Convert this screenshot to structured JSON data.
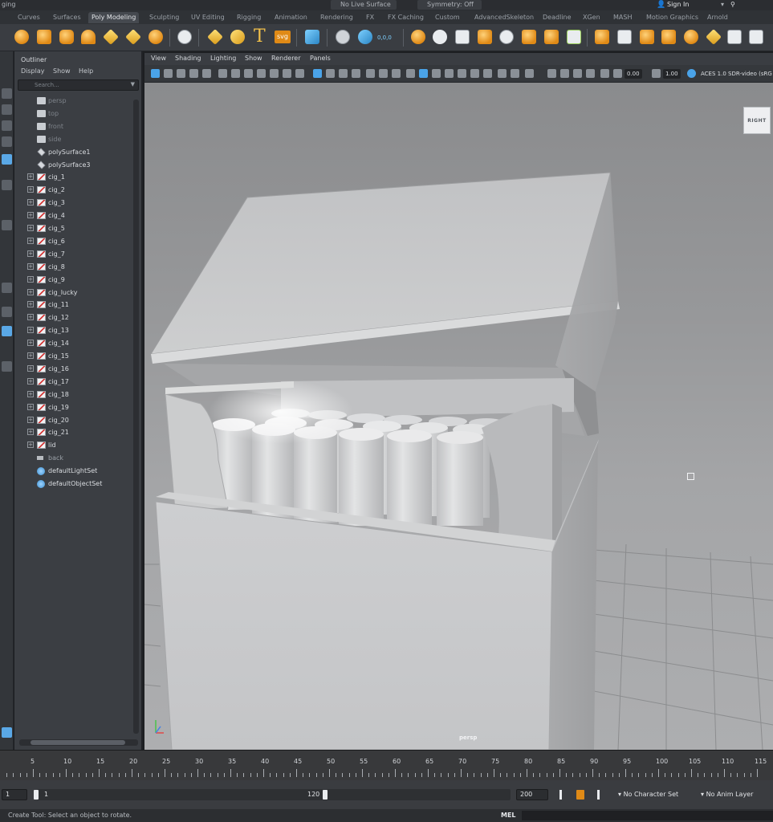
{
  "topbar": {
    "mode": "ging",
    "live_surface": "No Live Surface",
    "symmetry": "Symmetry: Off",
    "sign_in": "Sign In"
  },
  "shelf_tabs": [
    {
      "label": "Curves",
      "active": false
    },
    {
      "label": "Surfaces",
      "active": false
    },
    {
      "label": "Poly Modeling",
      "active": true
    },
    {
      "label": "Sculpting",
      "active": false
    },
    {
      "label": "UV Editing",
      "active": false
    },
    {
      "label": "Rigging",
      "active": false
    },
    {
      "label": "Animation",
      "active": false
    },
    {
      "label": "Rendering",
      "active": false
    },
    {
      "label": "FX",
      "active": false
    },
    {
      "label": "FX Caching",
      "active": false
    },
    {
      "label": "Custom",
      "active": false
    },
    {
      "label": "AdvancedSkeleton",
      "active": false
    },
    {
      "label": "Deadline",
      "active": false
    },
    {
      "label": "XGen",
      "active": false
    },
    {
      "label": "MASH",
      "active": false
    },
    {
      "label": "Motion Graphics",
      "active": false
    },
    {
      "label": "Arnold",
      "active": false
    }
  ],
  "shelf": {
    "text_tool_glyph": "T",
    "svg_tool_label": "svg",
    "counter_label": "0,0,0"
  },
  "outliner": {
    "title": "Outliner",
    "menus": [
      "Display",
      "Show",
      "Help"
    ],
    "search_placeholder": "Search...",
    "items": [
      {
        "label": "persp",
        "icon": "camera-icon",
        "dim": true,
        "expander": false
      },
      {
        "label": "top",
        "icon": "camera-icon",
        "dim": true,
        "expander": false
      },
      {
        "label": "front",
        "icon": "camera-icon",
        "dim": true,
        "expander": false
      },
      {
        "label": "side",
        "icon": "camera-icon",
        "dim": true,
        "expander": false
      },
      {
        "label": "polySurface1",
        "icon": "poly-surface-icon",
        "dim": false,
        "expander": false
      },
      {
        "label": "polySurface3",
        "icon": "poly-surface-icon",
        "dim": false,
        "expander": false
      },
      {
        "label": "cig_1",
        "icon": "mesh-icon",
        "dim": false,
        "expander": true
      },
      {
        "label": "cig_2",
        "icon": "mesh-icon",
        "dim": false,
        "expander": true
      },
      {
        "label": "cig_3",
        "icon": "mesh-icon",
        "dim": false,
        "expander": true
      },
      {
        "label": "cig_4",
        "icon": "mesh-icon",
        "dim": false,
        "expander": true
      },
      {
        "label": "cig_5",
        "icon": "mesh-icon",
        "dim": false,
        "expander": true
      },
      {
        "label": "cig_6",
        "icon": "mesh-icon",
        "dim": false,
        "expander": true
      },
      {
        "label": "cig_7",
        "icon": "mesh-icon",
        "dim": false,
        "expander": true
      },
      {
        "label": "cig_8",
        "icon": "mesh-icon",
        "dim": false,
        "expander": true
      },
      {
        "label": "cig_9",
        "icon": "mesh-icon",
        "dim": false,
        "expander": true
      },
      {
        "label": "cig_lucky",
        "icon": "mesh-icon",
        "dim": false,
        "expander": true
      },
      {
        "label": "cig_11",
        "icon": "mesh-icon",
        "dim": false,
        "expander": true
      },
      {
        "label": "cig_12",
        "icon": "mesh-icon",
        "dim": false,
        "expander": true
      },
      {
        "label": "cig_13",
        "icon": "mesh-icon",
        "dim": false,
        "expander": true
      },
      {
        "label": "cig_14",
        "icon": "mesh-icon",
        "dim": false,
        "expander": true
      },
      {
        "label": "cig_15",
        "icon": "mesh-icon",
        "dim": false,
        "expander": true
      },
      {
        "label": "cig_16",
        "icon": "mesh-icon",
        "dim": false,
        "expander": true
      },
      {
        "label": "cig_17",
        "icon": "mesh-icon",
        "dim": false,
        "expander": true
      },
      {
        "label": "cig_18",
        "icon": "mesh-icon",
        "dim": false,
        "expander": true
      },
      {
        "label": "cig_19",
        "icon": "mesh-icon",
        "dim": false,
        "expander": true
      },
      {
        "label": "cig_20",
        "icon": "mesh-icon",
        "dim": false,
        "expander": true
      },
      {
        "label": "cig_21",
        "icon": "mesh-icon",
        "dim": false,
        "expander": true
      },
      {
        "label": "lid",
        "icon": "mesh-icon",
        "dim": false,
        "expander": true
      },
      {
        "label": "back",
        "icon": "group-icon",
        "dim": true,
        "expander": false
      },
      {
        "label": "defaultLightSet",
        "icon": "set-icon",
        "dim": false,
        "expander": false
      },
      {
        "label": "defaultObjectSet",
        "icon": "set-icon",
        "dim": false,
        "expander": false
      }
    ]
  },
  "viewport": {
    "menus": [
      "View",
      "Shading",
      "Lighting",
      "Show",
      "Renderer",
      "Panels"
    ],
    "exposure": "0.00",
    "gamma": "1.00",
    "color_space": "ACES 1.0 SDR-video (sRG",
    "viewcube_label": "RIGHT",
    "camera_label": "persp"
  },
  "timeline": {
    "ticks": [
      5,
      10,
      15,
      20,
      25,
      30,
      35,
      40,
      45,
      50,
      55,
      60,
      65,
      70,
      75,
      80,
      85,
      90,
      95,
      100,
      105,
      110,
      115
    ]
  },
  "range": {
    "start": "1",
    "inner_start": "1",
    "inner_end": "120",
    "end": "200",
    "character_set": "No Character Set",
    "anim_layer": "No Anim Layer"
  },
  "command": {
    "help_text": "Create Tool: Select an object to rotate.",
    "lang": "MEL"
  },
  "colors": {
    "accent": "#4aa3e8",
    "shelf_orange": "#e08a16",
    "viewport_bg": "#9a9b9d"
  }
}
